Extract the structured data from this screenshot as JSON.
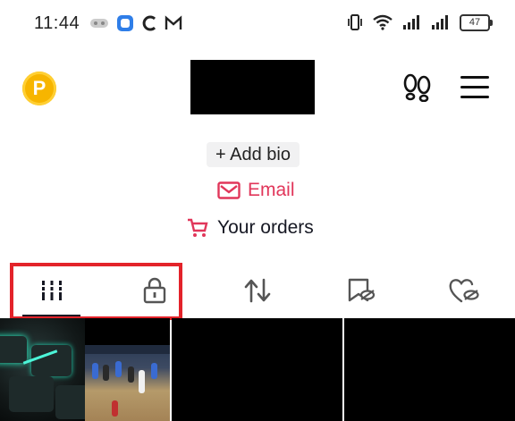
{
  "status_bar": {
    "time": "11:44",
    "battery": "47"
  },
  "header": {
    "coin_letter": "P"
  },
  "profile": {
    "add_bio": "+ Add bio",
    "email": "Email",
    "orders": "Your orders"
  },
  "tabs": [
    {
      "name": "videos",
      "icon": "grid-bars-icon",
      "selected": true
    },
    {
      "name": "private",
      "icon": "lock-icon"
    },
    {
      "name": "reposts",
      "icon": "repost-icon"
    },
    {
      "name": "favorites",
      "icon": "bookmark-hidden-icon"
    },
    {
      "name": "liked",
      "icon": "heart-hidden-icon"
    }
  ],
  "colors": {
    "accent": "#e1365a",
    "highlight_box": "#e3232a",
    "coin": "#f7b500"
  }
}
